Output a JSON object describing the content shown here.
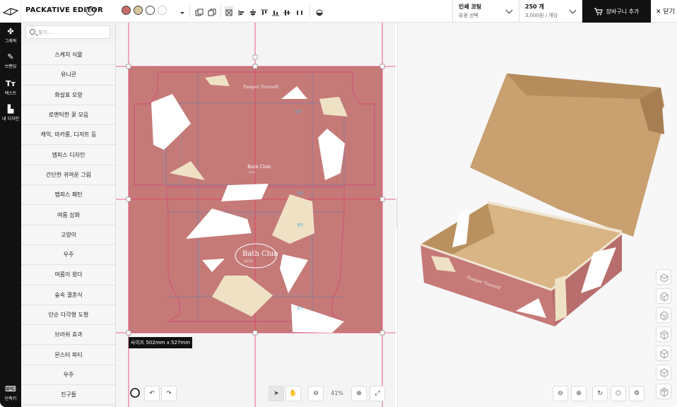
{
  "app": {
    "title": "PACKATIVE EDITOR",
    "help": "?"
  },
  "toolbar": {
    "swatch_colors": [
      "#c96a6a",
      "#d8c79b",
      "#ffffff",
      "#ffffff"
    ]
  },
  "print_option": {
    "label": "인쇄 코팅",
    "value": "유광 선택"
  },
  "quantity_option": {
    "label": "250 개",
    "value": "3,000원 / 개당"
  },
  "cart_button": "장바구니 추가",
  "close_button": "닫기",
  "rail": {
    "graphics": "그래픽",
    "branding": "브랜딩",
    "text": "텍스트",
    "my_design": "내 디자인",
    "shortcuts": "단축키",
    "text_icon": "Tт"
  },
  "search": {
    "placeholder": "찾기..."
  },
  "categories": [
    "스케치 식물",
    "유니콘",
    "화살표 모양",
    "로맨틱한 꽃 모음",
    "케익, 마카롱, 디저트 등",
    "멤피스 디자인",
    "간단한 귀여운 그림",
    "멤피스 패턴",
    "여름 삽화",
    "고양이",
    "우주",
    "여름이 왔다",
    "숲속 결혼식",
    "단순 다각형 도형",
    "브러쉬 효과",
    "몬스터 파티",
    "우주",
    "친구들"
  ],
  "dieline": {
    "pamper": "Pamper Yourself",
    "bath_small": "Bath Club",
    "bath_big": "Bath Club",
    "year": "2222",
    "year_small": "2222",
    "label_front": "앞면",
    "label_top": "윗면",
    "label_side": "옆면",
    "label_bottom": "밑면"
  },
  "size_label": "사이즈 502mm x 527mm",
  "zoom": "41%",
  "box3d": {
    "text": "Pamper Yourself"
  },
  "colors": {
    "box_pink": "#c57a78",
    "kraft": "#c9a06f",
    "accent": "#e8356b"
  }
}
